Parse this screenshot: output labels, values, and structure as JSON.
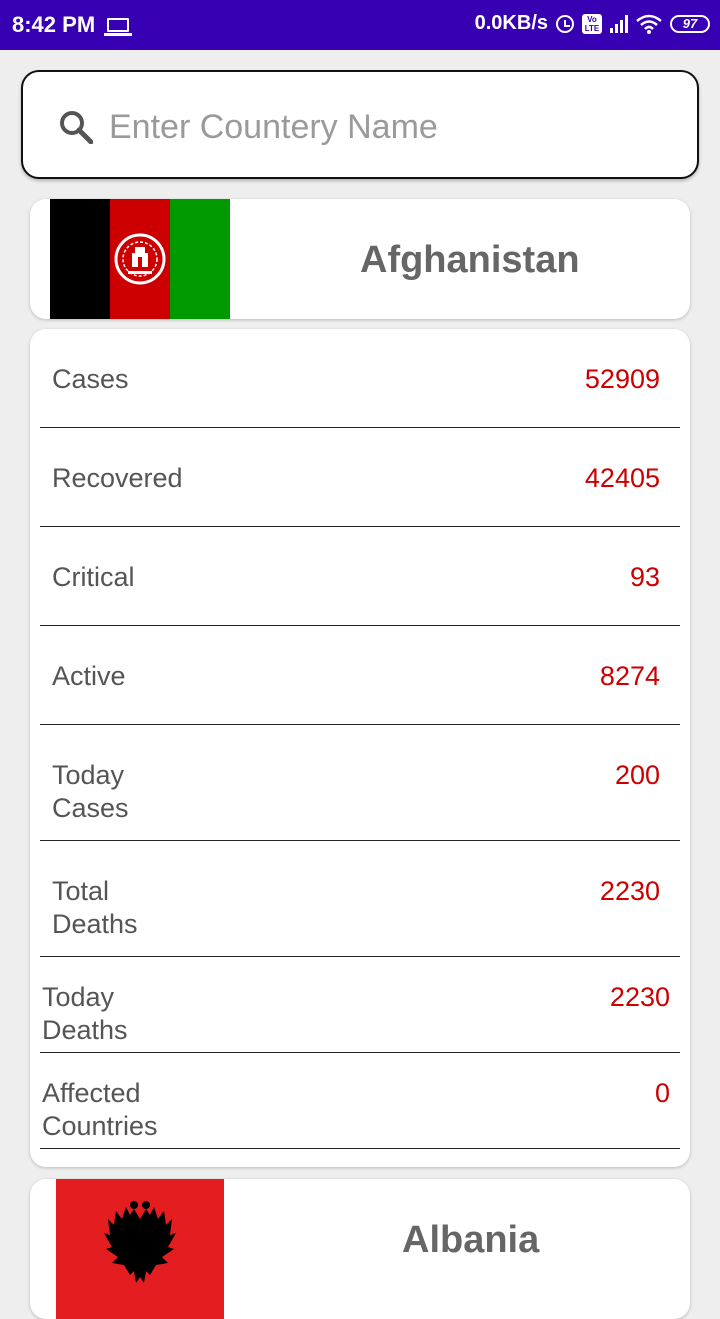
{
  "status_bar": {
    "time": "8:42 PM",
    "net_speed": "0.0KB/s",
    "volte_text": "Vo LTE",
    "battery": "97"
  },
  "search": {
    "placeholder": "Enter Countery Name",
    "value": ""
  },
  "countries": [
    {
      "name": "Afghanistan",
      "flag_colors": [
        "#000000",
        "#cc0000",
        "#009900"
      ],
      "flag_icon": "afghanistan-flag-icon"
    },
    {
      "name": "Albania",
      "flag_colors": [
        "#e41e20",
        "#000000"
      ],
      "flag_icon": "albania-flag-icon"
    }
  ],
  "stats": [
    {
      "label": "Cases",
      "value": "52909"
    },
    {
      "label": "Recovered",
      "value": "42405"
    },
    {
      "label": "Critical",
      "value": "93"
    },
    {
      "label": "Active",
      "value": "8274"
    },
    {
      "label": "Today Cases",
      "value": "200"
    },
    {
      "label": "Total Deaths",
      "value": "2230"
    },
    {
      "label": "Today Deaths",
      "value": "2230"
    },
    {
      "label": "Affected Countries",
      "value": "0"
    }
  ],
  "colors": {
    "status_bar": "#3700b3",
    "value_red": "#cc0000",
    "label_gray": "#555555",
    "background": "#eeeeee"
  }
}
